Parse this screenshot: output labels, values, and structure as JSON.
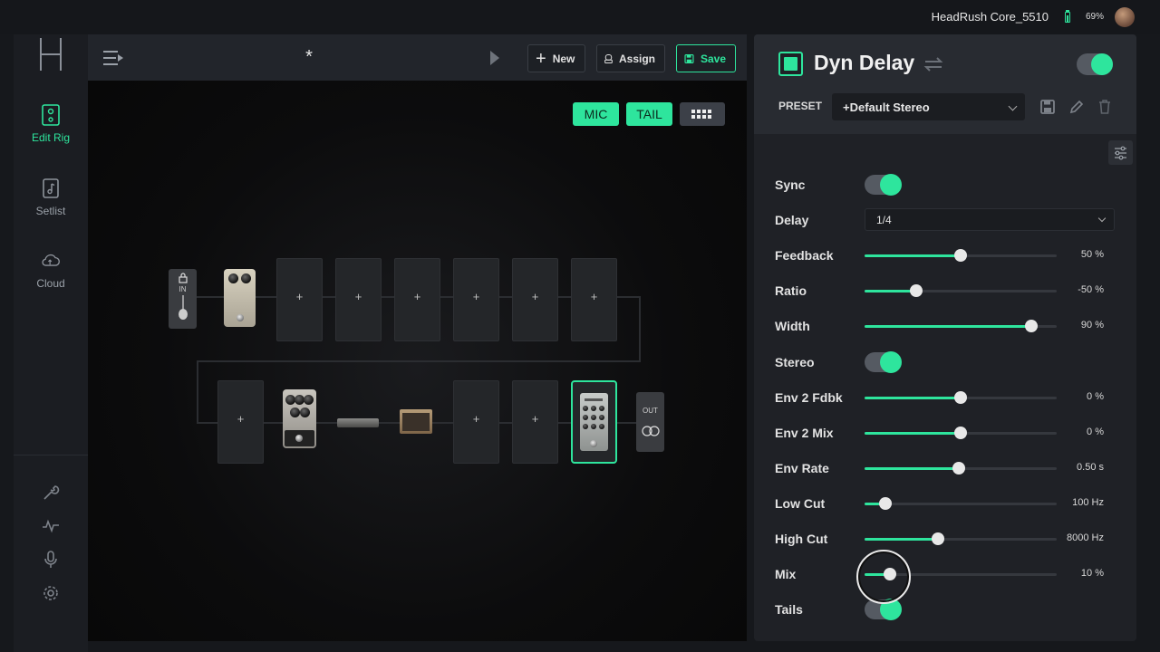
{
  "status": {
    "device_name": "HeadRush Core_5510",
    "battery_pct": "69%",
    "battery_level": 0.69
  },
  "nav": {
    "items": [
      {
        "label": "Edit Rig",
        "icon": "pedal-icon",
        "active": true
      },
      {
        "label": "Setlist",
        "icon": "setlist-icon",
        "active": false
      },
      {
        "label": "Cloud",
        "icon": "cloud-icon",
        "active": false
      }
    ],
    "tools": [
      "wrench-icon",
      "waveform-icon",
      "microphone-icon",
      "settings-gear-icon"
    ]
  },
  "rig": {
    "title": "*",
    "buttons": {
      "new": "New",
      "assign": "Assign",
      "save": "Save"
    },
    "pills": {
      "mic": "MIC",
      "tail": "TAIL"
    },
    "io": {
      "in": "IN",
      "out": "OUT"
    },
    "slot_plus": "+",
    "colors": {
      "accent": "#2ee59d",
      "background": "#0c0c0d"
    }
  },
  "panel": {
    "fx_name": "Dyn Delay",
    "fx_enabled": true,
    "preset_label": "PRESET",
    "preset_value": "+Default Stereo",
    "params": [
      {
        "label": "Sync",
        "kind": "toggle",
        "on": true
      },
      {
        "label": "Delay",
        "kind": "dropdown",
        "value": "1/4"
      },
      {
        "label": "Feedback",
        "kind": "slider",
        "value": "50 %",
        "level": 0.5
      },
      {
        "label": "Ratio",
        "kind": "slider",
        "value": "-50 %",
        "level": 0.27
      },
      {
        "label": "Width",
        "kind": "slider",
        "value": "90 %",
        "level": 0.87
      },
      {
        "label": "Stereo",
        "kind": "toggle",
        "on": true
      },
      {
        "label": "Env 2 Fdbk",
        "kind": "slider",
        "value": "0 %",
        "level": 0.5
      },
      {
        "label": "Env 2 Mix",
        "kind": "slider",
        "value": "0 %",
        "level": 0.5
      },
      {
        "label": "Env Rate",
        "kind": "slider",
        "value": "0.50 s",
        "level": 0.49
      },
      {
        "label": "Low Cut",
        "kind": "slider",
        "value": "100 Hz",
        "level": 0.11
      },
      {
        "label": "High Cut",
        "kind": "slider",
        "value": "8000 Hz",
        "level": 0.38
      },
      {
        "label": "Mix",
        "kind": "slider",
        "value": "10 %",
        "level": 0.13
      },
      {
        "label": "Tails",
        "kind": "toggle",
        "on": true
      }
    ]
  }
}
